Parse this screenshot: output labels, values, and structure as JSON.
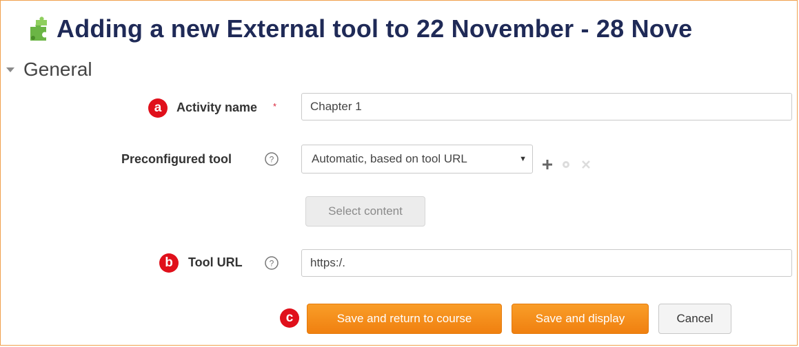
{
  "header": {
    "title": "Adding a new External tool to 22 November - 28 Nove",
    "icon": "puzzle-piece-icon"
  },
  "section": {
    "title": "General",
    "icon": "collapse-triangle-icon"
  },
  "form": {
    "activity_name": {
      "badge": "a",
      "label": "Activity name",
      "required_mark": "*",
      "value": "Chapter 1"
    },
    "preconfigured_tool": {
      "label": "Preconfigured tool",
      "help_icon": "question-circle-icon",
      "selected": "Automatic, based on tool URL",
      "actions": [
        "add-icon",
        "gear-icon",
        "close-icon"
      ]
    },
    "select_content_button": "Select content",
    "tool_url": {
      "badge": "b",
      "label": "Tool URL",
      "help_icon": "question-circle-icon",
      "value": "https:/."
    }
  },
  "buttons": {
    "badge": "c",
    "save_return": "Save and return to course",
    "save_display": "Save and display",
    "cancel": "Cancel"
  },
  "colors": {
    "accent_orange": "#f08010",
    "badge_red": "#e0101b",
    "title_navy": "#1f2a57",
    "frame_border": "#f0a04b"
  }
}
